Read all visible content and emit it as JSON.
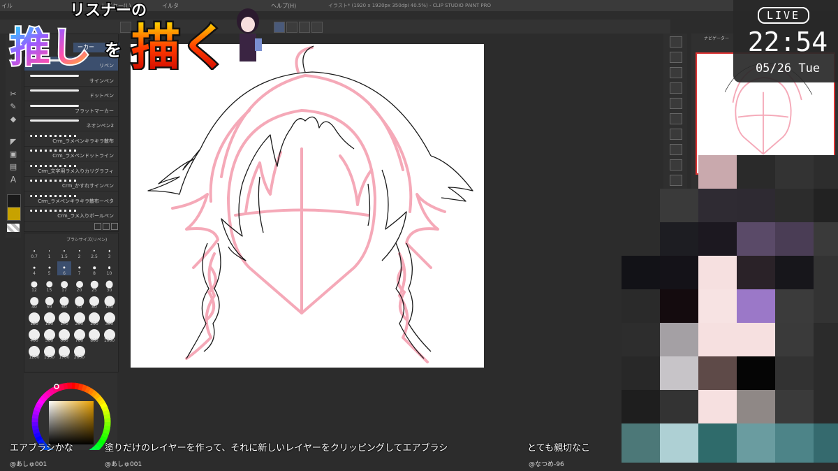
{
  "app": {
    "title": "イラスト* (1920 x 1920px 350dpi 40.5%) - CLIP STUDIO PAINT PRO",
    "menus": [
      "イル",
      "レイヤー(L)",
      "イルタ",
      "ヘルプ(H)"
    ]
  },
  "logo": {
    "line1": "リスナーの",
    "line2_a": "推し",
    "line2_b": "を",
    "line2_c": "描く"
  },
  "brush_panel": {
    "tab_label": "ーカー",
    "items": [
      {
        "label": "リペン"
      },
      {
        "label": "サインペン"
      },
      {
        "label": "ドットペン"
      },
      {
        "label": "フラットマーカー"
      },
      {
        "label": "ネオンペン2"
      },
      {
        "label": "Crm_ラメペンキラキラ散布"
      },
      {
        "label": "Crm_ラメペンドットライン"
      },
      {
        "label": "Crm_文字用ラメ入りカリグラフィ"
      },
      {
        "label": "Crm_かすれサインペン"
      },
      {
        "label": "Crm_ラメペンキラキラ散布ーベタ"
      },
      {
        "label": "Crm_ラメ入りボールペン"
      }
    ]
  },
  "size_panel": {
    "title": "ブラシサイズ(リペン)",
    "sizes": [
      "0.7",
      "1",
      "1.5",
      "2",
      "2.5",
      "3",
      "4",
      "5",
      "6",
      "7",
      "8",
      "10",
      "12",
      "15",
      "17",
      "20",
      "25",
      "30",
      "40",
      "50",
      "60",
      "70",
      "80",
      "100",
      "120",
      "150",
      "170",
      "200",
      "250",
      "300",
      "400",
      "500",
      "600",
      "700",
      "800",
      "1000",
      "1200",
      "1500",
      "1700",
      "2000"
    ],
    "selected": "6"
  },
  "navigator": {
    "title": "ナビゲーター"
  },
  "live": {
    "badge": "LIVE",
    "time": "22:54",
    "date": "05/26 Tue"
  },
  "chat": [
    {
      "text": "エアブラシかな",
      "user": "@あしゅ001"
    },
    {
      "text": "塗りだけのレイヤーを作って、それに新しいレイヤーをクリッピングしてエアブラシ",
      "user": "@あしゅ001"
    },
    {
      "text": "とても親切なこ",
      "user": "@なつめ-96"
    }
  ],
  "colors": {
    "canvas_bg": "#ffffff",
    "sketch_pink": "#f5a9b8",
    "line_black": "#1a1a1a",
    "app_bg": "#2c2c2c",
    "palette_fg": "#c7a200",
    "logo_red": "#e60012"
  },
  "icons": {
    "tools": [
      "lasso-icon",
      "pen-icon",
      "eraser-icon",
      "fill-icon",
      "gradient-icon",
      "figure-icon",
      "text-icon"
    ],
    "right": [
      "search-icon",
      "layer-icon",
      "material-icon",
      "property-icon",
      "history-icon",
      "navigator-icon"
    ]
  }
}
